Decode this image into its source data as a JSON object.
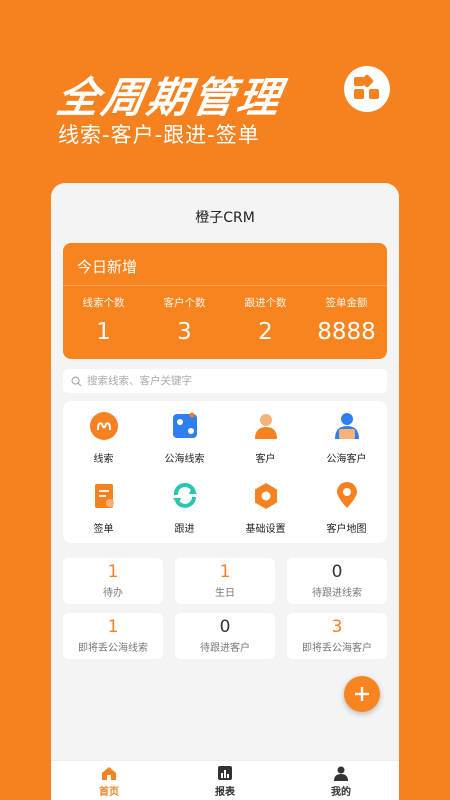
{
  "hero": {
    "title": "全周期管理",
    "subtitle": "线索-客户-跟进-签单"
  },
  "app": {
    "title": "橙子CRM"
  },
  "today": {
    "title": "今日新增",
    "stats": [
      {
        "label": "线索个数",
        "value": "1"
      },
      {
        "label": "客户个数",
        "value": "3"
      },
      {
        "label": "跟进个数",
        "value": "2"
      },
      {
        "label": "签单金额",
        "value": "8888"
      }
    ]
  },
  "search": {
    "placeholder": "搜索线索、客户关键字"
  },
  "grid": [
    {
      "label": "线索",
      "icon": "lead-icon"
    },
    {
      "label": "公海线索",
      "icon": "public-lead-icon"
    },
    {
      "label": "客户",
      "icon": "customer-icon"
    },
    {
      "label": "公海客户",
      "icon": "public-customer-icon"
    },
    {
      "label": "签单",
      "icon": "contract-icon"
    },
    {
      "label": "跟进",
      "icon": "follow-up-icon"
    },
    {
      "label": "基础设置",
      "icon": "settings-icon"
    },
    {
      "label": "客户地图",
      "icon": "map-pin-icon"
    }
  ],
  "counters": [
    {
      "value": "1",
      "label": "待办",
      "color": "#f5821f"
    },
    {
      "value": "1",
      "label": "生日",
      "color": "#f5821f"
    },
    {
      "value": "0",
      "label": "待跟进线索",
      "color": "#333333"
    },
    {
      "value": "1",
      "label": "即将丢公海线索",
      "color": "#f5821f"
    },
    {
      "value": "0",
      "label": "待跟进客户",
      "color": "#333333"
    },
    {
      "value": "3",
      "label": "即将丢公海客户",
      "color": "#f5821f"
    }
  ],
  "tabs": [
    {
      "label": "首页",
      "icon": "home-icon",
      "active": true
    },
    {
      "label": "报表",
      "icon": "report-icon",
      "active": false
    },
    {
      "label": "我的",
      "icon": "profile-icon",
      "active": false
    }
  ],
  "colors": {
    "brand": "#f5821f",
    "blue": "#2f7ff0",
    "teal": "#26c6b0"
  }
}
